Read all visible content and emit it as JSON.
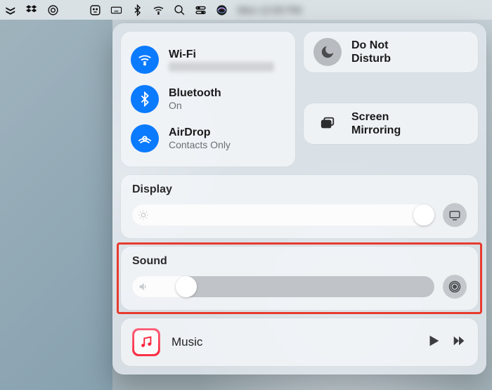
{
  "menubar": {
    "clock_text": "Mon 12:00 PM"
  },
  "control_center": {
    "connectivity": {
      "wifi": {
        "title": "Wi-Fi",
        "sub": "Network"
      },
      "bluetooth": {
        "title": "Bluetooth",
        "sub": "On"
      },
      "airdrop": {
        "title": "AirDrop",
        "sub": "Contacts Only"
      }
    },
    "dnd": {
      "title": "Do Not Disturb"
    },
    "mirror": {
      "title": "Screen Mirroring"
    },
    "display": {
      "title": "Display",
      "value_pct": 95
    },
    "sound": {
      "title": "Sound",
      "value_pct": 18
    },
    "music": {
      "title": "Music"
    }
  }
}
